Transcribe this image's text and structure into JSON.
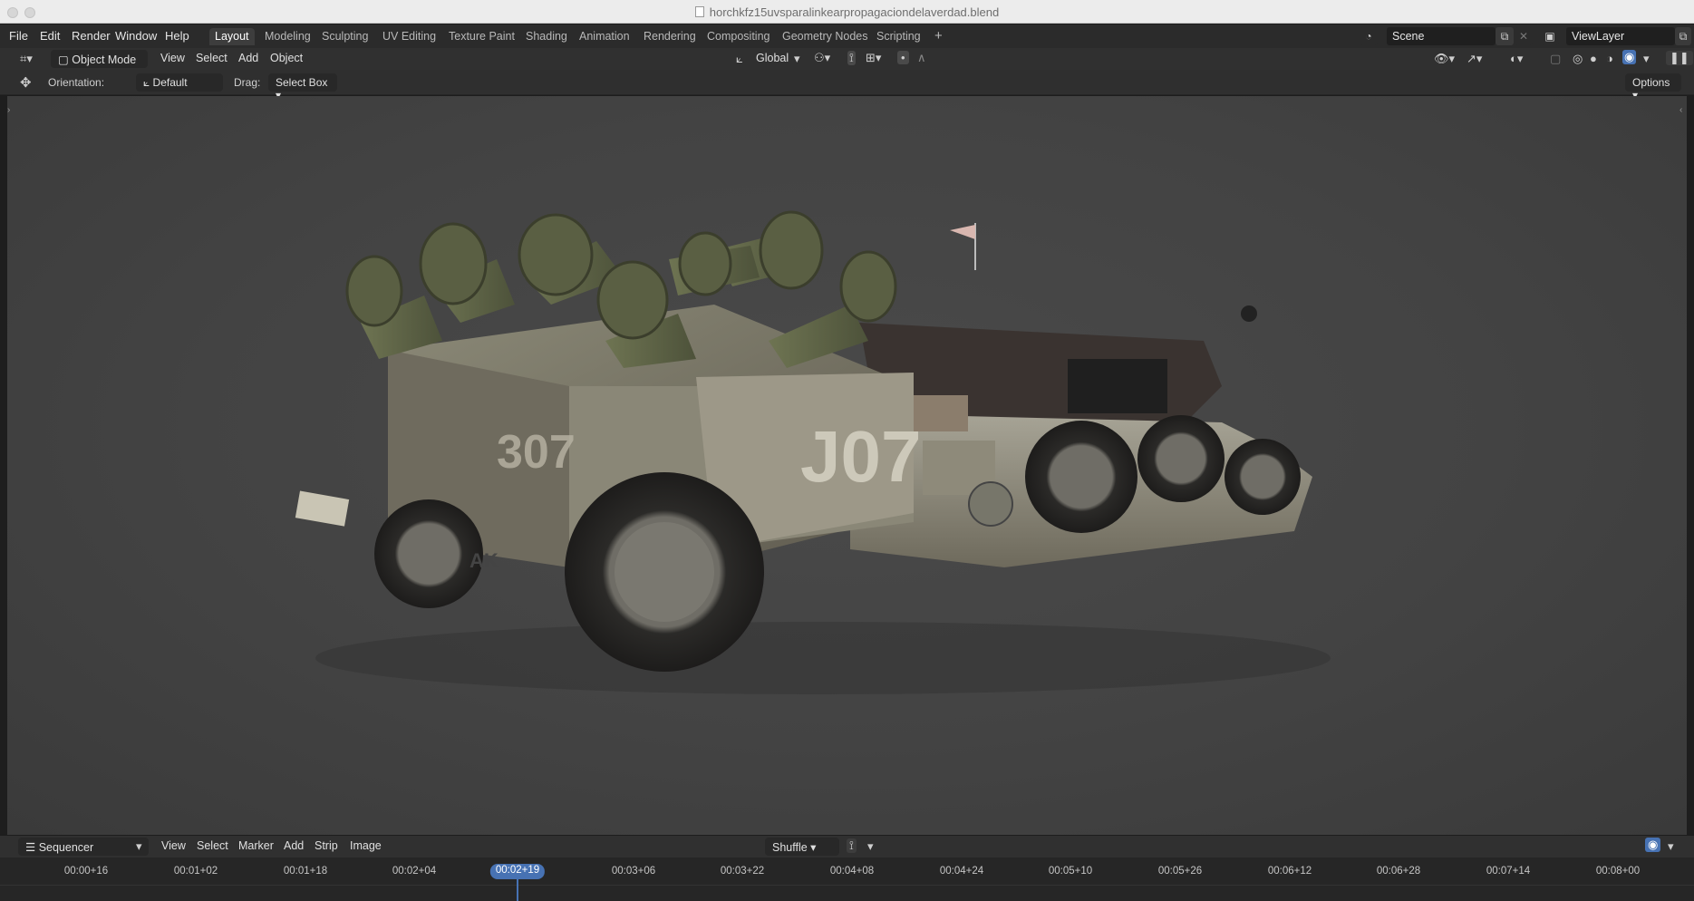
{
  "window": {
    "title": "horchkfz15uvsparalinkearpropagaciondelaverdad.blend"
  },
  "menu": [
    "File",
    "Edit",
    "Render",
    "Window",
    "Help"
  ],
  "workspaces": [
    "Layout",
    "Modeling",
    "Sculpting",
    "UV Editing",
    "Texture Paint",
    "Shading",
    "Animation",
    "Rendering",
    "Compositing",
    "Geometry Nodes",
    "Scripting"
  ],
  "active_workspace": "Layout",
  "add_workspace_label": "+",
  "scene": {
    "name": "Scene",
    "view_layer": "ViewLayer"
  },
  "viewport_header": {
    "mode": "Object Mode",
    "menus": [
      "View",
      "Select",
      "Add",
      "Object"
    ],
    "transform_orientation": "Global"
  },
  "tool_settings": {
    "orientation_label": "Orientation:",
    "orientation_value": "Default",
    "drag_label": "Drag:",
    "drag_value": "Select Box",
    "options_label": "Options"
  },
  "sequencer": {
    "editor_type": "Sequencer",
    "menus": [
      "View",
      "Select",
      "Marker",
      "Add",
      "Strip",
      "Image"
    ],
    "snap_mode": "Shuffle",
    "current_time": "00:02+19",
    "ticks": [
      "00:00+16",
      "00:01+02",
      "00:01+18",
      "00:02+04",
      "00:03+06",
      "00:03+22",
      "00:04+08",
      "00:04+24",
      "00:05+10",
      "00:05+26",
      "00:06+12",
      "00:06+28",
      "00:07+14",
      "00:08+00"
    ]
  },
  "scene_content": {
    "trailer_number": "307",
    "trailer_side_number": "J07",
    "wheel_emblem": "AK"
  },
  "colors": {
    "accent_blue": "#4772b3",
    "viewport_bg": "#444444",
    "panel_bg": "#303030"
  }
}
